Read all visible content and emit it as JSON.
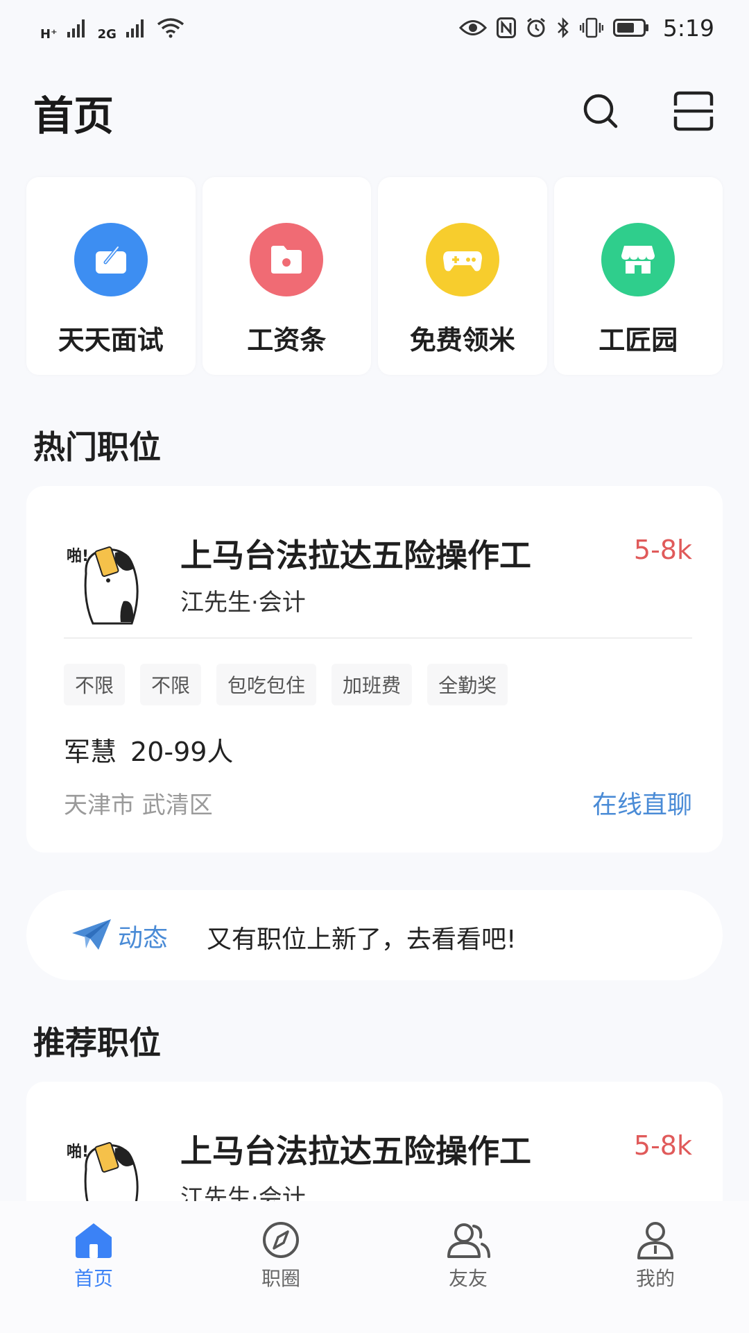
{
  "status_bar": {
    "network1": "H⁺",
    "network2": "2G",
    "time": "5:19"
  },
  "header": {
    "title": "首页",
    "search_icon": "search-icon",
    "scan_icon": "scan-icon"
  },
  "quick_actions": [
    {
      "label": "天天面试",
      "icon": "interview-icon",
      "color": "#3d8ef2"
    },
    {
      "label": "工资条",
      "icon": "folder-icon",
      "color": "#f06b74"
    },
    {
      "label": "免费领米",
      "icon": "gamepad-icon",
      "color": "#f7cd2d"
    },
    {
      "label": "工匠园",
      "icon": "store-icon",
      "color": "#2fce8c"
    }
  ],
  "hot_section": {
    "title": "热门职位"
  },
  "hot_job": {
    "title": "上马台法拉达五险操作工",
    "salary": "5-8k",
    "poster": "江先生·会计",
    "tags": [
      "不限",
      "不限",
      "包吃包住",
      "加班费",
      "全勤奖"
    ],
    "company": "军慧",
    "company_size": "20-99人",
    "location": "天津市 武清区",
    "chat": "在线直聊"
  },
  "news": {
    "label": "动态",
    "text": "又有职位上新了，去看看吧!"
  },
  "recommend_section": {
    "title": "推荐职位"
  },
  "recommend_job": {
    "title": "上马台法拉达五险操作工",
    "salary": "5-8k",
    "poster": "江先生·会计"
  },
  "tabbar": [
    {
      "label": "首页",
      "icon": "home-icon",
      "active": true
    },
    {
      "label": "职圈",
      "icon": "compass-icon",
      "active": false
    },
    {
      "label": "友友",
      "icon": "friends-icon",
      "active": false
    },
    {
      "label": "我的",
      "icon": "profile-icon",
      "active": false
    }
  ],
  "colors": {
    "accent": "#3b82f6",
    "salary": "#e05a5a",
    "link": "#4a8bd6"
  }
}
